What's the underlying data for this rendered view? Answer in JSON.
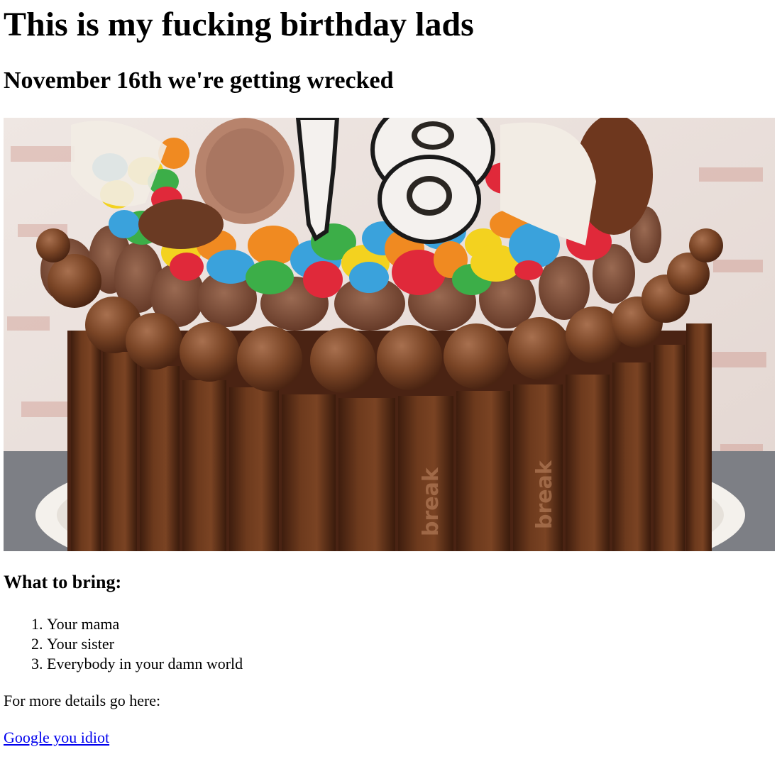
{
  "header": {
    "title": "This is my fucking birthday lads",
    "subtitle": "November 16th we're getting wrecked"
  },
  "image": {
    "subject": "chocolate-cake-18",
    "candle_number": "18",
    "wrapper_text": "break"
  },
  "bring": {
    "heading": "What to bring:",
    "items": [
      "Your mama",
      "Your sister",
      "Everybody in your damn world"
    ]
  },
  "details": {
    "text": "For more details go here:",
    "link_label": "Google you idiot"
  },
  "colors": {
    "link": "#0000ee",
    "text": "#000000",
    "background": "#ffffff"
  }
}
